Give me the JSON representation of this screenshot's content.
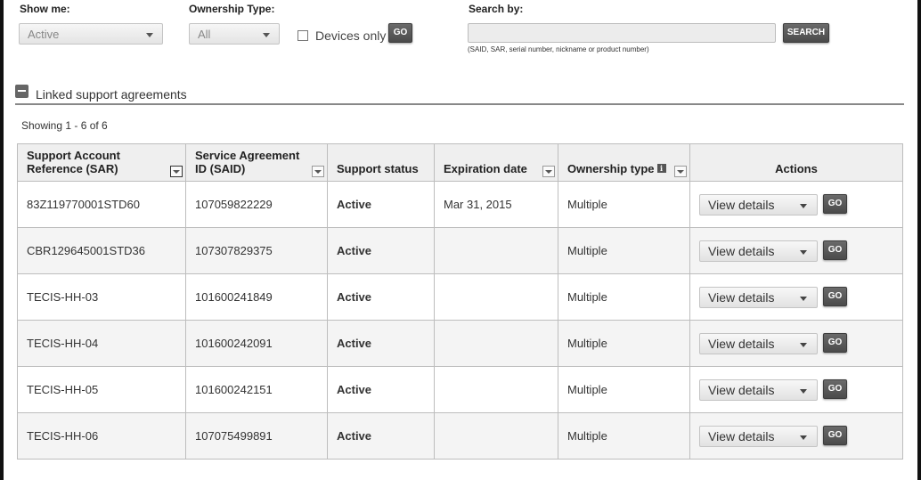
{
  "filters": {
    "show_me": {
      "label": "Show me:",
      "value": "Active"
    },
    "ownership_type": {
      "label": "Ownership Type:",
      "value": "All"
    },
    "devices_only": {
      "label": "Devices only",
      "checked": false
    },
    "go_label": "GO",
    "search": {
      "label": "Search by:",
      "value": "",
      "button": "SEARCH",
      "hint": "(SAID, SAR, serial number, nickname or product number)"
    }
  },
  "section": {
    "title": "Linked support agreements",
    "showing": "Showing 1 - 6 of 6"
  },
  "table": {
    "headers": {
      "sar": "Support Account Reference (SAR)",
      "said": "Service Agreement ID (SAID)",
      "status": "Support status",
      "expiration": "Expiration date",
      "ownership": "Ownership type",
      "actions": "Actions"
    },
    "rows": [
      {
        "sar": "83Z119770001STD60",
        "said": "107059822229",
        "status": "Active",
        "expiration": "Mar 31, 2015",
        "ownership": "Multiple",
        "action": "View details",
        "go": "GO"
      },
      {
        "sar": "CBR129645001STD36",
        "said": "107307829375",
        "status": "Active",
        "expiration": "",
        "ownership": "Multiple",
        "action": "View details",
        "go": "GO"
      },
      {
        "sar": "TECIS-HH-03",
        "said": "101600241849",
        "status": "Active",
        "expiration": "",
        "ownership": "Multiple",
        "action": "View details",
        "go": "GO"
      },
      {
        "sar": "TECIS-HH-04",
        "said": "101600242091",
        "status": "Active",
        "expiration": "",
        "ownership": "Multiple",
        "action": "View details",
        "go": "GO"
      },
      {
        "sar": "TECIS-HH-05",
        "said": "101600242151",
        "status": "Active",
        "expiration": "",
        "ownership": "Multiple",
        "action": "View details",
        "go": "GO"
      },
      {
        "sar": "TECIS-HH-06",
        "said": "107075499891",
        "status": "Active",
        "expiration": "",
        "ownership": "Multiple",
        "action": "View details",
        "go": "GO"
      }
    ]
  },
  "icons": {
    "collapse": "minus-square-icon",
    "sort": "sort-dropdown-icon",
    "info": "info-icon",
    "caret": "chevron-down-icon"
  },
  "colors": {
    "button_dark": "#555555",
    "status_text": "#999999",
    "header_bg": "#efefef"
  }
}
